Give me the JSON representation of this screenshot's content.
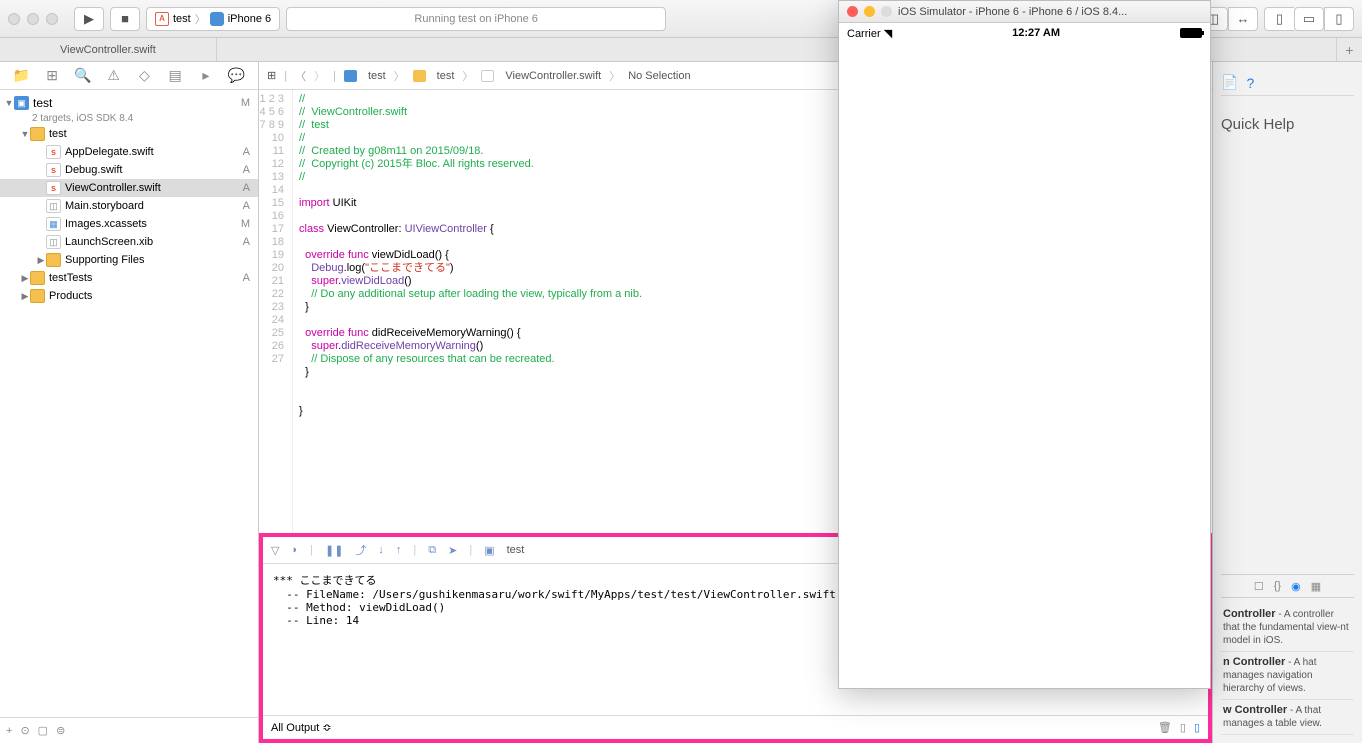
{
  "toolbar": {
    "scheme_app": "test",
    "scheme_device": "iPhone 6",
    "activity": "Running test on iPhone 6"
  },
  "tab": {
    "title": "ViewController.swift"
  },
  "project": {
    "name": "test",
    "subtitle": "2 targets, iOS SDK 8.4",
    "status": "M",
    "tree": [
      {
        "indent": 1,
        "disc": "▼",
        "icon": "folder",
        "label": "test",
        "status": ""
      },
      {
        "indent": 2,
        "disc": "",
        "icon": "swift",
        "label": "AppDelegate.swift",
        "status": "A"
      },
      {
        "indent": 2,
        "disc": "",
        "icon": "swift",
        "label": "Debug.swift",
        "status": "A"
      },
      {
        "indent": 2,
        "disc": "",
        "icon": "swift",
        "label": "ViewController.swift",
        "status": "A",
        "sel": true
      },
      {
        "indent": 2,
        "disc": "",
        "icon": "story",
        "label": "Main.storyboard",
        "status": "A"
      },
      {
        "indent": 2,
        "disc": "",
        "icon": "asset",
        "label": "Images.xcassets",
        "status": "M"
      },
      {
        "indent": 2,
        "disc": "",
        "icon": "xib",
        "label": "LaunchScreen.xib",
        "status": "A"
      },
      {
        "indent": 2,
        "disc": "▶",
        "icon": "folder",
        "label": "Supporting Files",
        "status": ""
      },
      {
        "indent": 1,
        "disc": "▶",
        "icon": "folder",
        "label": "testTests",
        "status": "A"
      },
      {
        "indent": 1,
        "disc": "▶",
        "icon": "folder",
        "label": "Products",
        "status": ""
      }
    ]
  },
  "jumpbar": {
    "p1": "test",
    "p2": "test",
    "p3": "ViewController.swift",
    "p4": "No Selection"
  },
  "code": {
    "lines": [
      {
        "n": 1,
        "seg": [
          {
            "t": "//",
            "c": "c-comment"
          }
        ]
      },
      {
        "n": 2,
        "seg": [
          {
            "t": "//  ViewController.swift",
            "c": "c-comment"
          }
        ]
      },
      {
        "n": 3,
        "seg": [
          {
            "t": "//  test",
            "c": "c-comment"
          }
        ]
      },
      {
        "n": 4,
        "seg": [
          {
            "t": "//",
            "c": "c-comment"
          }
        ]
      },
      {
        "n": 5,
        "seg": [
          {
            "t": "//  Created by g08m11 on 2015/09/18.",
            "c": "c-comment"
          }
        ]
      },
      {
        "n": 6,
        "seg": [
          {
            "t": "//  Copyright (c) 2015年 Bloc. All rights reserved.",
            "c": "c-comment"
          }
        ]
      },
      {
        "n": 7,
        "seg": [
          {
            "t": "//",
            "c": "c-comment"
          }
        ]
      },
      {
        "n": 8,
        "seg": [
          {
            "t": "",
            "c": ""
          }
        ]
      },
      {
        "n": 9,
        "seg": [
          {
            "t": "import",
            "c": "c-kw"
          },
          {
            "t": " UIKit",
            "c": ""
          }
        ]
      },
      {
        "n": 10,
        "seg": [
          {
            "t": "",
            "c": ""
          }
        ]
      },
      {
        "n": 11,
        "seg": [
          {
            "t": "class",
            "c": "c-kw"
          },
          {
            "t": " ViewController: ",
            "c": ""
          },
          {
            "t": "UIViewController",
            "c": "c-type"
          },
          {
            "t": " {",
            "c": ""
          }
        ]
      },
      {
        "n": 12,
        "seg": [
          {
            "t": "",
            "c": ""
          }
        ]
      },
      {
        "n": 13,
        "seg": [
          {
            "t": "  ",
            "c": ""
          },
          {
            "t": "override",
            "c": "c-kw"
          },
          {
            "t": " ",
            "c": ""
          },
          {
            "t": "func",
            "c": "c-kw"
          },
          {
            "t": " viewDidLoad() {",
            "c": ""
          }
        ]
      },
      {
        "n": 14,
        "seg": [
          {
            "t": "    ",
            "c": ""
          },
          {
            "t": "Debug",
            "c": "c-type"
          },
          {
            "t": ".log(",
            "c": ""
          },
          {
            "t": "\"ここまできてる\"",
            "c": "c-str"
          },
          {
            "t": ")",
            "c": ""
          }
        ]
      },
      {
        "n": 15,
        "seg": [
          {
            "t": "    ",
            "c": ""
          },
          {
            "t": "super",
            "c": "c-kw"
          },
          {
            "t": ".",
            "c": ""
          },
          {
            "t": "viewDidLoad",
            "c": "c-type"
          },
          {
            "t": "()",
            "c": ""
          }
        ]
      },
      {
        "n": 16,
        "seg": [
          {
            "t": "    ",
            "c": ""
          },
          {
            "t": "// Do any additional setup after loading the view, typically from a nib.",
            "c": "c-comment"
          }
        ]
      },
      {
        "n": 17,
        "seg": [
          {
            "t": "  }",
            "c": ""
          }
        ]
      },
      {
        "n": 18,
        "seg": [
          {
            "t": "",
            "c": ""
          }
        ]
      },
      {
        "n": 19,
        "seg": [
          {
            "t": "  ",
            "c": ""
          },
          {
            "t": "override",
            "c": "c-kw"
          },
          {
            "t": " ",
            "c": ""
          },
          {
            "t": "func",
            "c": "c-kw"
          },
          {
            "t": " didReceiveMemoryWarning() {",
            "c": ""
          }
        ]
      },
      {
        "n": 20,
        "seg": [
          {
            "t": "    ",
            "c": ""
          },
          {
            "t": "super",
            "c": "c-kw"
          },
          {
            "t": ".",
            "c": ""
          },
          {
            "t": "didReceiveMemoryWarning",
            "c": "c-type"
          },
          {
            "t": "()",
            "c": ""
          }
        ]
      },
      {
        "n": 21,
        "seg": [
          {
            "t": "    ",
            "c": ""
          },
          {
            "t": "// Dispose of any resources that can be recreated.",
            "c": "c-comment"
          }
        ]
      },
      {
        "n": 22,
        "seg": [
          {
            "t": "  }",
            "c": ""
          }
        ]
      },
      {
        "n": 23,
        "seg": [
          {
            "t": "",
            "c": ""
          }
        ]
      },
      {
        "n": 24,
        "seg": [
          {
            "t": "",
            "c": ""
          }
        ]
      },
      {
        "n": 25,
        "seg": [
          {
            "t": "}",
            "c": ""
          }
        ]
      },
      {
        "n": 26,
        "seg": [
          {
            "t": "",
            "c": ""
          }
        ]
      },
      {
        "n": 27,
        "seg": [
          {
            "t": "",
            "c": ""
          }
        ]
      }
    ]
  },
  "debug": {
    "target": "test",
    "output": "*** ここまできてる\n  -- FileName: /Users/gushikenmasaru/work/swift/MyApps/test/test/ViewController.swift\n  -- Method: viewDidLoad()\n  -- Line: 14",
    "filter": "All Output ≎"
  },
  "inspector": {
    "title": "Quick Help",
    "lib": [
      {
        "title": "Controller",
        "desc": " - A controller that the fundamental view-nt model in iOS."
      },
      {
        "title": "n Controller",
        "desc": " - A hat manages navigation hierarchy of views."
      },
      {
        "title": "w Controller",
        "desc": " - A that manages a table view."
      }
    ]
  },
  "simulator": {
    "title": "iOS Simulator - iPhone 6 - iPhone 6 / iOS 8.4...",
    "carrier": "Carrier",
    "time": "12:27 AM"
  }
}
